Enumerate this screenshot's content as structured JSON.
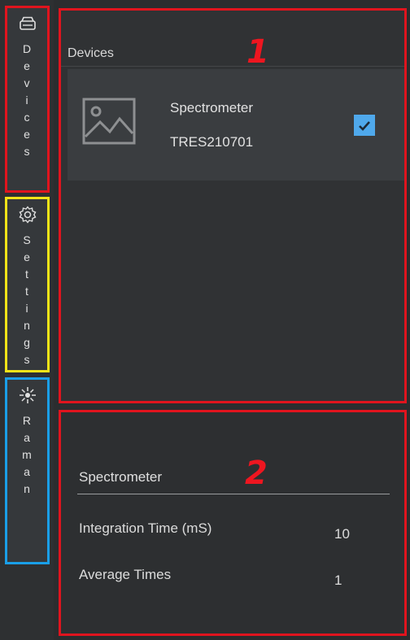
{
  "sidebar": {
    "tabs": [
      {
        "label": "Devices",
        "icon": "drive-icon",
        "highlight": "#e0141e"
      },
      {
        "label": "Settings",
        "icon": "gear-icon",
        "highlight": "#f2e418"
      },
      {
        "label": "Raman",
        "icon": "laser-icon",
        "highlight": "#1a9fe8"
      }
    ]
  },
  "devices_panel": {
    "badge": "1",
    "header": "Devices",
    "devices": [
      {
        "name": "Spectrometer",
        "serial": "TRES210701",
        "checked": true,
        "thumbnail_icon": "image-placeholder-icon"
      }
    ]
  },
  "settings_panel": {
    "badge": "2",
    "section_title": "Spectrometer",
    "fields": [
      {
        "label": "Integration Time  (mS)",
        "value": "10"
      },
      {
        "label": "Average Times",
        "value": "1"
      }
    ]
  },
  "colors": {
    "accent_check": "#4fa9ec",
    "annotation_red": "#e0141e",
    "annotation_yellow": "#f2e418",
    "annotation_blue": "#1a9fe8"
  }
}
